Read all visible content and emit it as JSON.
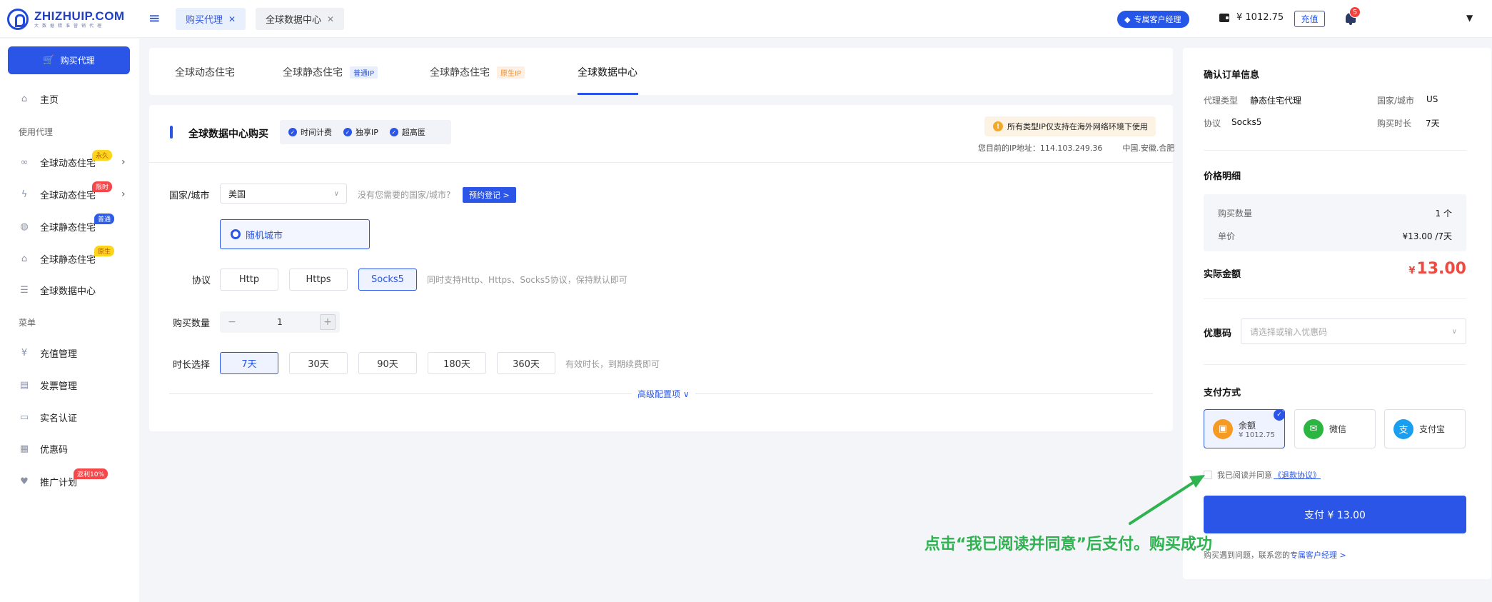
{
  "header": {
    "logo_name": "ZHIZHUIP.COM",
    "logo_sub": "大数据精准营销代理",
    "tabs": [
      {
        "label": "购买代理"
      },
      {
        "label": "全球数据中心"
      }
    ],
    "manager_btn": "专属客户经理",
    "balance": "¥ 1012.75",
    "recharge": "充值",
    "notif_count": "5"
  },
  "sidebar": {
    "buy_btn": "购买代理",
    "home": "主页",
    "group_proxy": "使用代理",
    "items": [
      {
        "label": "全球动态住宅",
        "badge": "永久"
      },
      {
        "label": "全球动态住宅",
        "badge": "限时"
      },
      {
        "label": "全球静态住宅",
        "badge": "普通"
      },
      {
        "label": "全球静态住宅",
        "badge": "原生"
      },
      {
        "label": "全球数据中心"
      }
    ],
    "group_menu": "菜单",
    "menu": [
      {
        "label": "充值管理"
      },
      {
        "label": "发票管理"
      },
      {
        "label": "实名认证"
      },
      {
        "label": "优惠码"
      },
      {
        "label": "推广计划",
        "badge": "返利10%"
      }
    ]
  },
  "product_tabs": [
    {
      "label": "全球动态住宅"
    },
    {
      "label": "全球静态住宅",
      "tag": "普通IP"
    },
    {
      "label": "全球静态住宅",
      "tag": "原生IP"
    },
    {
      "label": "全球数据中心"
    }
  ],
  "form": {
    "title": "全球数据中心购买",
    "features": [
      "时间计费",
      "独享IP",
      "超高匿"
    ],
    "notice": "所有类型IP仅支持在海外网络环境下使用",
    "ip_label": "您目前的IP地址：114.103.249.36",
    "ip_location": "中国.安徽.合肥",
    "country_label": "国家/城市",
    "country_value": "美国",
    "country_hint": "没有您需要的国家/城市?",
    "register_btn": "预约登记 >",
    "city_option": "随机城市",
    "protocol_label": "协议",
    "protocols": [
      "Http",
      "Https",
      "Socks5"
    ],
    "protocol_hint": "同时支持Http、Https、Socks5协议，保持默认即可",
    "qty_label": "购买数量",
    "qty_value": "1",
    "duration_label": "时长选择",
    "durations": [
      "7天",
      "30天",
      "90天",
      "180天",
      "360天"
    ],
    "duration_hint": "有效时长，到期续费即可",
    "advanced": "高级配置项"
  },
  "summary": {
    "title": "确认订单信息",
    "proxy_type_k": "代理类型",
    "proxy_type_v": "静态住宅代理",
    "country_k": "国家/城市",
    "country_v": "US",
    "protocol_k": "协议",
    "protocol_v": "Socks5",
    "duration_k": "购买时长",
    "duration_v": "7天",
    "price_title": "价格明细",
    "qty_k": "购买数量",
    "qty_v": "1 个",
    "unit_k": "单价",
    "unit_v": "¥13.00 /7天",
    "actual_k": "实际金额",
    "actual_cur": "¥",
    "actual_v": "13.00",
    "coupon_k": "优惠码",
    "coupon_placeholder": "请选择或输入优惠码",
    "pay_title": "支付方式",
    "pay_methods": [
      {
        "name": "余额",
        "sub": "¥ 1012.75"
      },
      {
        "name": "微信"
      },
      {
        "name": "支付宝"
      }
    ],
    "agree_text": "我已阅读并同意",
    "agree_link": "《退款协议》",
    "pay_btn": "支付 ¥ 13.00",
    "help_text": "购买遇到问题，联系您的",
    "help_link": "专属客户经理 >"
  },
  "annotation": "点击“我已阅读并同意”后支付。购买成功",
  "colors": {
    "accent": "#2a55e6",
    "price": "#f1483f",
    "annotation": "#2fb350"
  }
}
